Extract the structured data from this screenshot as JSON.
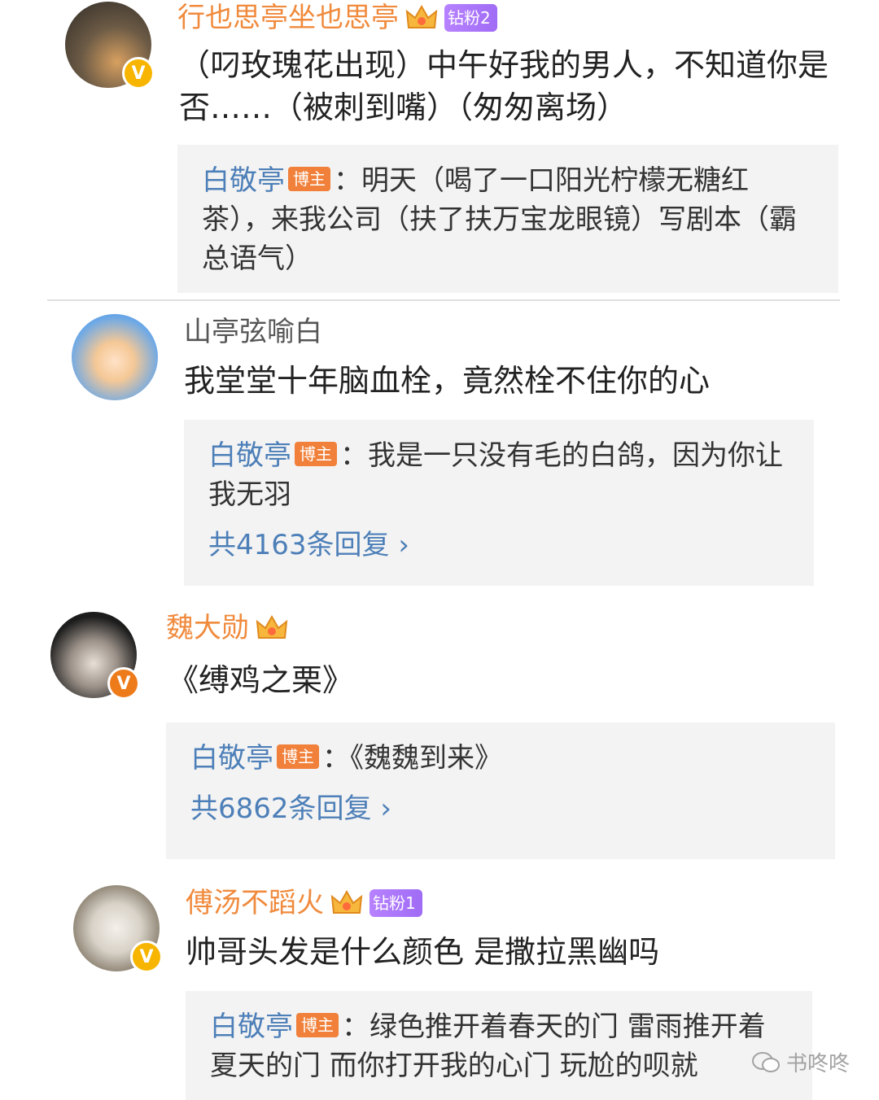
{
  "comments": [
    {
      "username": "行也思亭坐也思亭",
      "fan_badge": "钻粉2",
      "text": "（叼玫瑰花出现）中午好我的男人，不知道你是否……（被刺到嘴）（匆匆离场）",
      "reply": {
        "name": "白敬亭",
        "tag": "博主",
        "text": "：明天（喝了一口阳光柠檬无糖红茶），来我公司（扶了扶万宝龙眼镜）写剧本（霸总语气）"
      }
    },
    {
      "username": "山亭弦喻白",
      "text": "我堂堂十年脑血栓，竟然栓不住你的心",
      "reply": {
        "name": "白敬亭",
        "tag": "博主",
        "text": "：我是一只没有毛的白鸽，因为你让我无羽",
        "more": "共4163条回复 ›"
      }
    },
    {
      "username": "魏大勋",
      "text": "《缚鸡之栗》",
      "reply": {
        "name": "白敬亭",
        "tag": "博主",
        "text": "：《魏魏到来》",
        "more": "共6862条回复 ›"
      }
    },
    {
      "username": "傅汤不蹈火",
      "fan_badge": "钻粉1",
      "text": "帅哥头发是什么颜色 是撒拉黑幽吗",
      "reply": {
        "name": "白敬亭",
        "tag": "博主",
        "text": "：绿色推开着春天的门 雷雨推开着夏天的门 而你打开我的心门 玩尬的呗就"
      }
    }
  ],
  "watermark": "书咚咚",
  "colors": {
    "username_orange": "#f08a3c",
    "reply_name_blue": "#4d7fb8",
    "tag_orange": "#f0803a",
    "fan_badge_purple": "#a06cf5"
  }
}
